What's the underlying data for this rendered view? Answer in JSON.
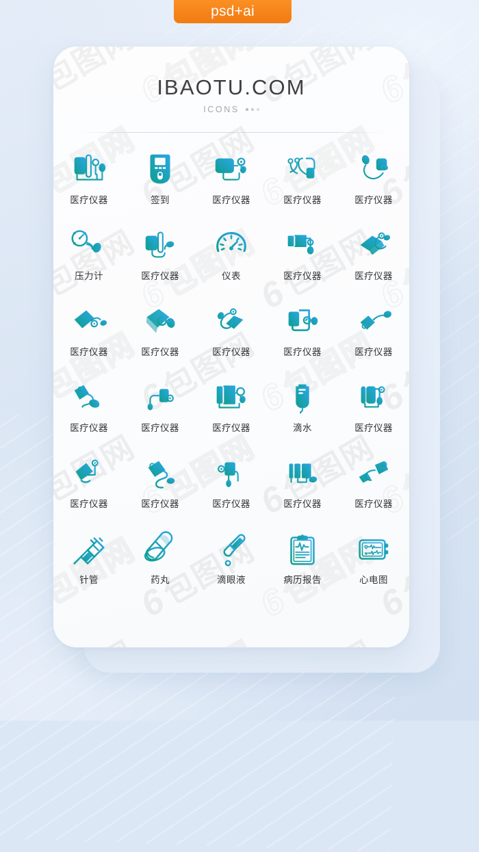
{
  "badge": {
    "label": "psd+ai",
    "color": "#f6831a"
  },
  "card": {
    "brand": "IBAOTU.COM",
    "subtitle": "ICONS"
  },
  "theme": {
    "page_background": "#dce7f5",
    "card_background": "#fbfcfd",
    "label_color": "#353538",
    "icon_gradient_start": "#0f9e8d",
    "icon_gradient_end": "#2aa7e6"
  },
  "watermark": {
    "text": "6 包图网"
  },
  "grid": {
    "columns": 5,
    "rows": 6,
    "items": [
      {
        "label": "医疗仪器",
        "icon": "bp-monitor-cuff-bulb-icon"
      },
      {
        "label": "签到",
        "icon": "glucose-meter-icon"
      },
      {
        "label": "医疗仪器",
        "icon": "cuff-gauge-bulb-icon"
      },
      {
        "label": "医疗仪器",
        "icon": "stethoscope-cuff-icon"
      },
      {
        "label": "医疗仪器",
        "icon": "bulb-cuff-curve-icon"
      },
      {
        "label": "压力计",
        "icon": "pressure-gauge-bulb-icon"
      },
      {
        "label": "医疗仪器",
        "icon": "cuff-dial-bulb-icon"
      },
      {
        "label": "仪表",
        "icon": "speedometer-icon"
      },
      {
        "label": "医疗仪器",
        "icon": "cuff-tube-gauge-icon"
      },
      {
        "label": "医疗仪器",
        "icon": "tilted-cuff-gauge-icon"
      },
      {
        "label": "医疗仪器",
        "icon": "slanted-cuff-bulb-icon"
      },
      {
        "label": "医疗仪器",
        "icon": "open-cuff-dial-icon"
      },
      {
        "label": "医疗仪器",
        "icon": "diagonal-cuff-loop-icon"
      },
      {
        "label": "医疗仪器",
        "icon": "cuff-panel-dial-icon"
      },
      {
        "label": "医疗仪器",
        "icon": "small-cuff-bulb-icon"
      },
      {
        "label": "医疗仪器",
        "icon": "tag-cuff-bulb-icon"
      },
      {
        "label": "医疗仪器",
        "icon": "cuff-dial-drip-icon"
      },
      {
        "label": "医疗仪器",
        "icon": "folded-cuff-gauge-icon"
      },
      {
        "label": "滴水",
        "icon": "iv-drip-bag-icon"
      },
      {
        "label": "医疗仪器",
        "icon": "rolled-cuff-gauge-icon"
      },
      {
        "label": "医疗仪器",
        "icon": "tilt-cuff-pin-icon"
      },
      {
        "label": "医疗仪器",
        "icon": "cuff-long-tube-icon"
      },
      {
        "label": "医疗仪器",
        "icon": "upright-cuff-bulb-icon"
      },
      {
        "label": "医疗仪器",
        "icon": "striped-cuff-bulb-icon"
      },
      {
        "label": "医疗仪器",
        "icon": "double-cuff-bulb-icon"
      },
      {
        "label": "针管",
        "icon": "syringe-icon"
      },
      {
        "label": "药丸",
        "icon": "pills-capsule-icon"
      },
      {
        "label": "滴眼液",
        "icon": "eye-drops-icon"
      },
      {
        "label": "病历报告",
        "icon": "medical-report-clipboard-icon"
      },
      {
        "label": "心电图",
        "icon": "ecg-monitor-icon"
      }
    ]
  }
}
